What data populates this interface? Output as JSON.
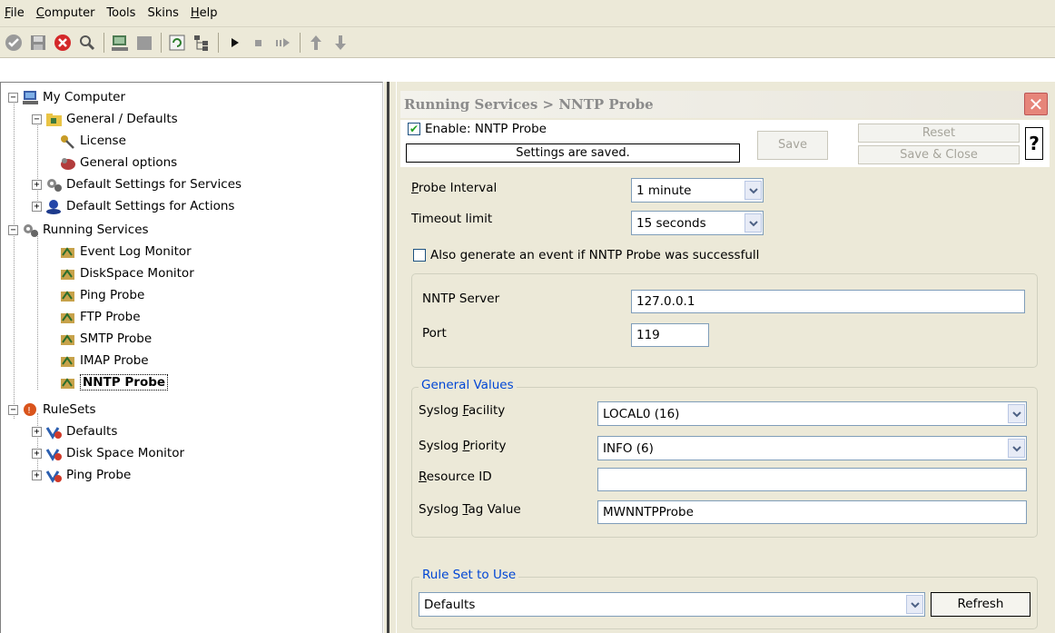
{
  "menu": [
    "File",
    "Computer",
    "Tools",
    "Skins",
    "Help"
  ],
  "toolbar": {
    "icons": [
      "check-circle-icon",
      "save-icon",
      "stop-red-icon",
      "search-icon",
      "computer-icon",
      "blank-icon",
      "refresh-icon",
      "tree-icon",
      "play-icon",
      "stop-icon",
      "step-icon",
      "arrow-up-icon",
      "arrow-down-icon"
    ]
  },
  "tree": {
    "root": "My Computer",
    "general": "General / Defaults",
    "license": "License",
    "general_options": "General options",
    "default_services": "Default Settings for Services",
    "default_actions": "Default Settings for Actions",
    "running_services": "Running Services",
    "services": [
      "Event Log Monitor",
      "DiskSpace Monitor",
      "Ping Probe",
      "FTP Probe",
      "SMTP Probe",
      "IMAP Probe",
      "NNTP Probe"
    ],
    "rulesets": "RuleSets",
    "rulesets_items": [
      "Defaults",
      "Disk Space Monitor",
      "Ping Probe"
    ]
  },
  "panel": {
    "title": "Running Services > NNTP Probe",
    "close": "✕",
    "enable_label": "Enable: NNTP Probe",
    "enable_checked": true,
    "status": "Settings are saved.",
    "save": "Save",
    "reset": "Reset",
    "save_close": "Save & Close",
    "help": "?"
  },
  "form": {
    "probe_interval_label_u": "P",
    "probe_interval_label_rest": "robe Interval",
    "probe_interval": "1 minute",
    "timeout_label": "Timeout limit",
    "timeout": "15 seconds",
    "also_generate": "Also generate an event if NNTP Probe was successfull",
    "also_generate_checked": false,
    "nntp_server_label": "NNTP Server",
    "nntp_server": "127.0.0.1",
    "port_label": "Port",
    "port": "119"
  },
  "general_values": {
    "title": "General Values",
    "facility_label_a": "Syslog ",
    "facility_label_u": "F",
    "facility_label_b": "acility",
    "facility": "LOCAL0 (16)",
    "priority_label_a": "Syslog ",
    "priority_label_u": "P",
    "priority_label_b": "riority",
    "priority": "INFO (6)",
    "resource_label_u": "R",
    "resource_label_b": "esource ID",
    "resource": "",
    "tag_label_a": "Syslog ",
    "tag_label_u": "T",
    "tag_label_b": "ag Value",
    "tag": "MWNNTPProbe"
  },
  "rule_set": {
    "title": "Rule Set to Use",
    "value": "Defaults",
    "refresh": "Refresh"
  }
}
